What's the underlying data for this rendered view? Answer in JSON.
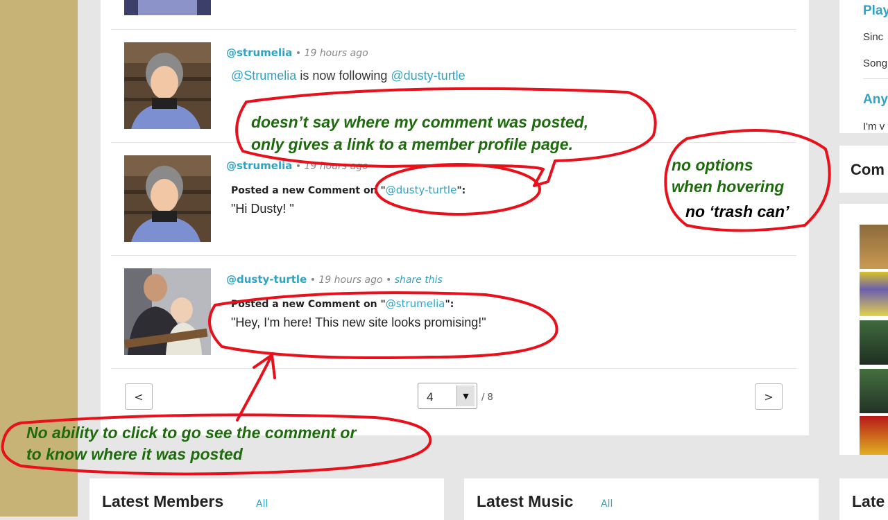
{
  "feed": {
    "items": [
      {
        "user": "@strumelia",
        "meta": " • 19 hours ago",
        "line_a": "@Strumelia",
        "line_b": " is now following ",
        "line_c": "@dusty-turtle"
      },
      {
        "user": "@strumelia",
        "meta": " • 19 hours ago",
        "posted_prefix": "Posted a new Comment on \"",
        "posted_link": "@dusty-turtle",
        "posted_suffix": "\":",
        "quote": "\"Hi Dusty!   \""
      },
      {
        "user": "@dusty-turtle",
        "meta": " • 19 hours ago • ",
        "share": "share this",
        "posted_prefix": "Posted a new Comment on \"",
        "posted_link": "@strumelia",
        "posted_suffix": "\":",
        "quote": "\"Hey, I'm here!  This new site looks promising!\""
      }
    ]
  },
  "pagination": {
    "prev": "<",
    "next": ">",
    "current": "4",
    "total": "/ 8"
  },
  "right": {
    "link1": "Play",
    "text1": "Sinc",
    "text2": "Song",
    "link2": "Any",
    "text3": "I'm v",
    "head": "Com"
  },
  "cards": {
    "members": "Latest Members",
    "music": "Latest Music",
    "all": "All",
    "third": "Late"
  },
  "annotations": {
    "note1_l1": "doesn’t say where my comment was posted,",
    "note1_l2": "only gives a link to a member profile page.",
    "note2_l1": "no options",
    "note2_l2": "when hovering",
    "note2_l3": "no ‘trash can’",
    "note3_l1": "No ability to click to go see the comment or",
    "note3_l2": "to know where it was posted"
  },
  "colors": {
    "link": "#2fa3c4",
    "annotation_red": "#e8101a",
    "annotation_green": "#1e6b0d",
    "sidebar_tan": "#c7b376"
  }
}
